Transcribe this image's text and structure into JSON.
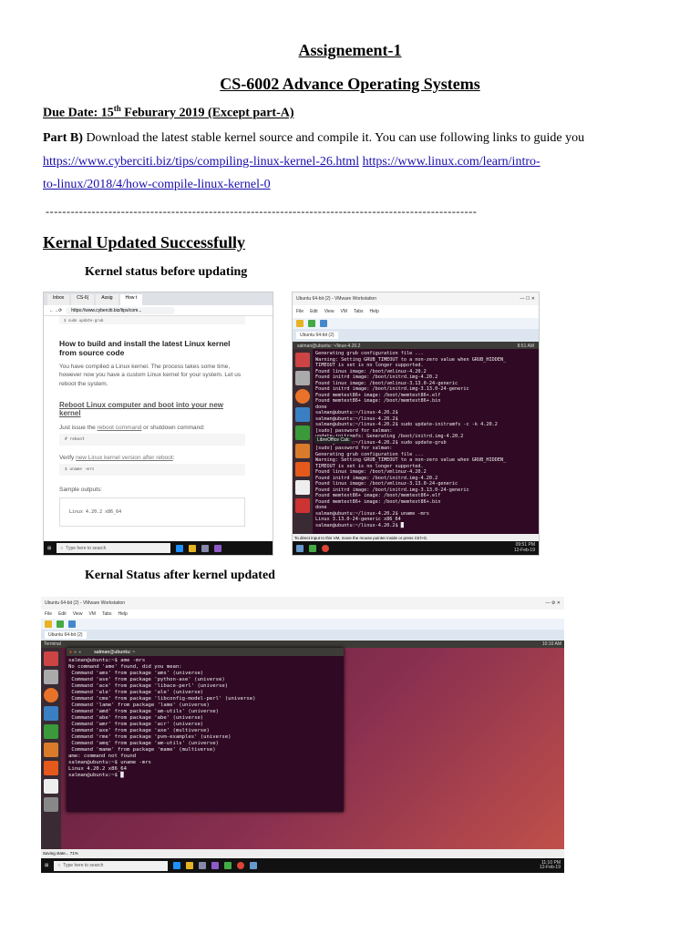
{
  "doc": {
    "title": "Assignement-1",
    "course": "CS-6002 Advance Operating Systems",
    "due_prefix": "Due Date: 15",
    "due_sup": "th",
    "due_suffix": " Feburary 2019 (Except part-A)",
    "partb_label": "Part B)",
    "partb_text": " Download the latest stable kernel source and compile it. You can use following links to guide you",
    "link1": "https://www.cyberciti.biz/tips/compiling-linux-kernel-26.html",
    "link2a": "https://www.linux.com/learn/intro-",
    "link2b": "to-linux/2018/4/how-compile-linux-kernel-0",
    "divider": "-------------------------------------------------------------------------------------------------------",
    "section": "Kernal Updated Successfully ",
    "caption1": "Kernel status before updating",
    "caption2": "Kernal Status after kernel updated"
  },
  "browser": {
    "tabs": [
      "Inbox",
      "CS-6(",
      "Assig",
      "How t"
    ],
    "url": "https://www.cyberciti.biz/tips/com...",
    "snippet": "$ sudo update-grub",
    "heading": "How to build and install the latest Linux kernel from source code",
    "para": "You have compiled a Linux kernel. The process takes some time, however now you have a custom Linux kernel for your system. Let us reboot the system.",
    "subheading": "Reboot Linux computer and boot into your new kernel",
    "issue_prefix": "Just issue the ",
    "issue_link": "reboot command",
    "issue_suffix": " or shutdown command:",
    "code1": "# reboot",
    "verify_prefix": "Verify ",
    "verify_link": "new Linux kernel version after reboot",
    "verify_suffix": ":",
    "code2": "$ uname -mrs",
    "sample": "Sample outputs:",
    "output": "Linux 4.20.2 x86_64",
    "search_placeholder": "Type here to search"
  },
  "vm1": {
    "title": "Ubuntu 64-bit (2) - VMware Workstation",
    "menu": [
      "File",
      "Edit",
      "View",
      "VM",
      "Tabs",
      "Help"
    ],
    "tab": "Ubuntu 64-bit (2)",
    "topbar": "salman@ubuntu: ~/linux-4.20.2",
    "time": "8:51 AM",
    "tooltip": "LibreOffice Calc",
    "lines": [
      "Generating grub configuration file ...",
      "Warning: Setting GRUB_TIMEOUT to a non-zero value when GRUB_HIDDEN_",
      "TIMEOUT is set is no longer supported.",
      "Found linux image: /boot/vmlinuz-4.20.2",
      "Found initrd image: /boot/initrd.img-4.20.2",
      "Found linux image: /boot/vmlinuz-3.13.0-24-generic",
      "Found initrd image: /boot/initrd.img-3.13.0-24-generic",
      "Found memtest86+ image: /boot/memtest86+.elf",
      "Found memtest86+ image: /boot/memtest86+.bin",
      "done",
      "salman@ubuntu:~/linux-4.20.2$",
      "salman@ubuntu:~/linux-4.20.2$",
      "salman@ubuntu:~/linux-4.20.2$ sudo update-initramfs -c -k 4.20.2",
      "[sudo] password for salman:",
      "update-initramfs: Generating /boot/initrd.img-4.20.2",
      "salman@ubuntu:~/linux-4.20.2$ sudo update-grub",
      "[sudo] password for salman:",
      "Generating grub configuration file ...",
      "Warning: Setting GRUB_TIMEOUT to a non-zero value when GRUB_HIDDEN_",
      "TIMEOUT is set is no longer supported.",
      "Found linux image: /boot/vmlinuz-4.20.2",
      "Found initrd image: /boot/initrd.img-4.20.2",
      "Found linux image: /boot/vmlinuz-3.13.0-24-generic",
      "Found initrd image: /boot/initrd.img-3.13.0-24-generic",
      "Found memtest86+ image: /boot/memtest86+.elf",
      "Found memtest86+ image: /boot/memtest86+.bin",
      "done",
      "salman@ubuntu:~/linux-4.20.2$ uname -mrs",
      "Linux 3.13.0-24-generic x86_64",
      "salman@ubuntu:~/linux-4.20.2$ █"
    ],
    "status": "To direct input to this VM, move the mouse pointer inside or press Ctrl+G.",
    "clock_time": "09:51 PM",
    "clock_date": "12-Feb-19"
  },
  "vm2": {
    "title": "Ubuntu 64-bit (2) - VMware Workstation",
    "menu": [
      "File",
      "Edit",
      "View",
      "VM",
      "Tabs",
      "Help"
    ],
    "tab": "Ubuntu 64-bit (2)",
    "topbar": "Terminal",
    "time": "10:10 AM",
    "term_title": "salman@ubuntu: ~",
    "lines": [
      "salman@ubuntu:~$ ame -mrs",
      "No command 'ame' found, did you mean:",
      " Command 'ams' from package 'ams' (universe)",
      " Command 'ase' from package 'python-ase' (universe)",
      " Command 'ace' from package 'libace-perl' (universe)",
      " Command 'ale' from package 'ale' (universe)",
      " Command 'cme' from package 'libconfig-model-perl' (universe)",
      " Command 'lame' from package 'lame' (universe)",
      " Command 'amd' from package 'am-utils' (universe)",
      " Command 'abe' from package 'abe' (universe)",
      " Command 'amr' from package 'acr' (universe)",
      " Command 'axe' from package 'axe' (multiverse)",
      " Command 'rme' from package 'pvm-examples' (universe)",
      " Command 'amq' from package 'am-utils' (universe)",
      " Command 'mame' from package 'mame' (multiverse)",
      "ame: command not found",
      "salman@ubuntu:~$ uname -mrs",
      "Linux 4.20.2 x86_64",
      "salman@ubuntu:~$ █"
    ],
    "status": "Saving state... 71%",
    "search_placeholder": "Type here to search",
    "clock_time": "11:10 PM",
    "clock_date": "12-Feb-19"
  }
}
